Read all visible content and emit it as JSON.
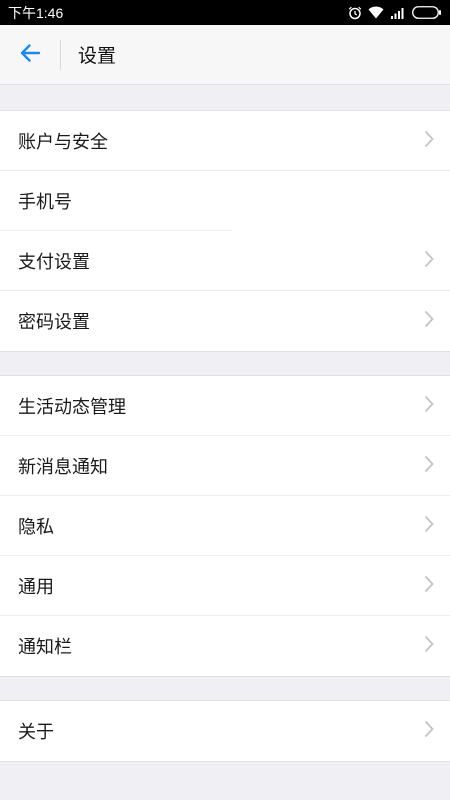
{
  "status": {
    "time": "下午1:46",
    "icons": [
      "alarm-icon",
      "wifi-icon",
      "signal-icon",
      "battery-icon"
    ]
  },
  "header": {
    "back_icon": "back-arrow-icon",
    "title": "设置",
    "accent": "#1e88e5"
  },
  "groups": [
    {
      "items": [
        {
          "label": "账户与安全",
          "chevron": true
        },
        {
          "label": "手机号",
          "chevron": false
        },
        {
          "label": "支付设置",
          "chevron": true
        },
        {
          "label": "密码设置",
          "chevron": true
        }
      ]
    },
    {
      "items": [
        {
          "label": "生活动态管理",
          "chevron": true
        },
        {
          "label": "新消息通知",
          "chevron": true
        },
        {
          "label": "隐私",
          "chevron": true
        },
        {
          "label": "通用",
          "chevron": true
        },
        {
          "label": "通知栏",
          "chevron": true
        }
      ]
    },
    {
      "items": [
        {
          "label": "关于",
          "chevron": true
        }
      ]
    }
  ]
}
